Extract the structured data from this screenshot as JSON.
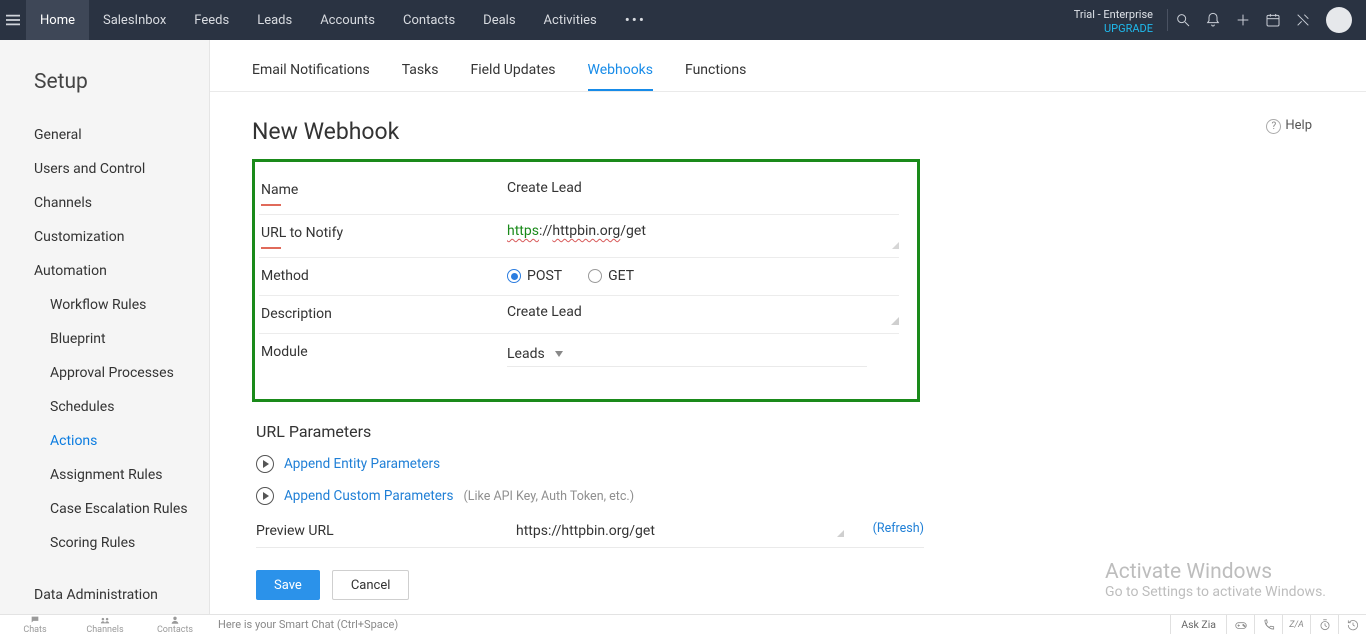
{
  "topnav": {
    "tabs": [
      "Home",
      "SalesInbox",
      "Feeds",
      "Leads",
      "Accounts",
      "Contacts",
      "Deals",
      "Activities"
    ],
    "more": "•••",
    "trial_line1": "Trial - Enterprise",
    "trial_line2": "UPGRADE"
  },
  "sidebar": {
    "title": "Setup",
    "items": [
      "General",
      "Users and Control",
      "Channels",
      "Customization",
      "Automation"
    ],
    "automation_children": [
      "Workflow Rules",
      "Blueprint",
      "Approval Processes",
      "Schedules",
      "Actions",
      "Assignment Rules",
      "Case Escalation Rules",
      "Scoring Rules"
    ],
    "automation_active": "Actions",
    "tail": [
      "Data Administration"
    ]
  },
  "subtabs": {
    "items": [
      "Email Notifications",
      "Tasks",
      "Field Updates",
      "Webhooks",
      "Functions"
    ],
    "active": "Webhooks"
  },
  "page": {
    "title": "New Webhook",
    "help": "Help"
  },
  "form": {
    "name_label": "Name",
    "name_value": "Create Lead",
    "url_label": "URL to Notify",
    "url_proto": "https",
    "url_sep": "://",
    "url_host": "httpbin.org",
    "url_path": "/get",
    "method_label": "Method",
    "method_post": "POST",
    "method_get": "GET",
    "desc_label": "Description",
    "desc_value": "Create Lead",
    "module_label": "Module",
    "module_value": "Leads"
  },
  "params": {
    "title": "URL Parameters",
    "append_entity": "Append Entity Parameters",
    "append_custom": "Append Custom Parameters",
    "append_custom_hint": "(Like API Key, Auth Token, etc.)",
    "preview_label": "Preview URL",
    "preview_value": "https://httpbin.org/get",
    "refresh": "(Refresh)"
  },
  "actions": {
    "save": "Save",
    "cancel": "Cancel"
  },
  "watermark": {
    "l1": "Activate Windows",
    "l2": "Go to Settings to activate Windows."
  },
  "footer": {
    "items": [
      "Chats",
      "Channels",
      "Contacts"
    ],
    "smart": "Here is your Smart Chat (Ctrl+Space)",
    "askzia": "Ask Zia"
  }
}
